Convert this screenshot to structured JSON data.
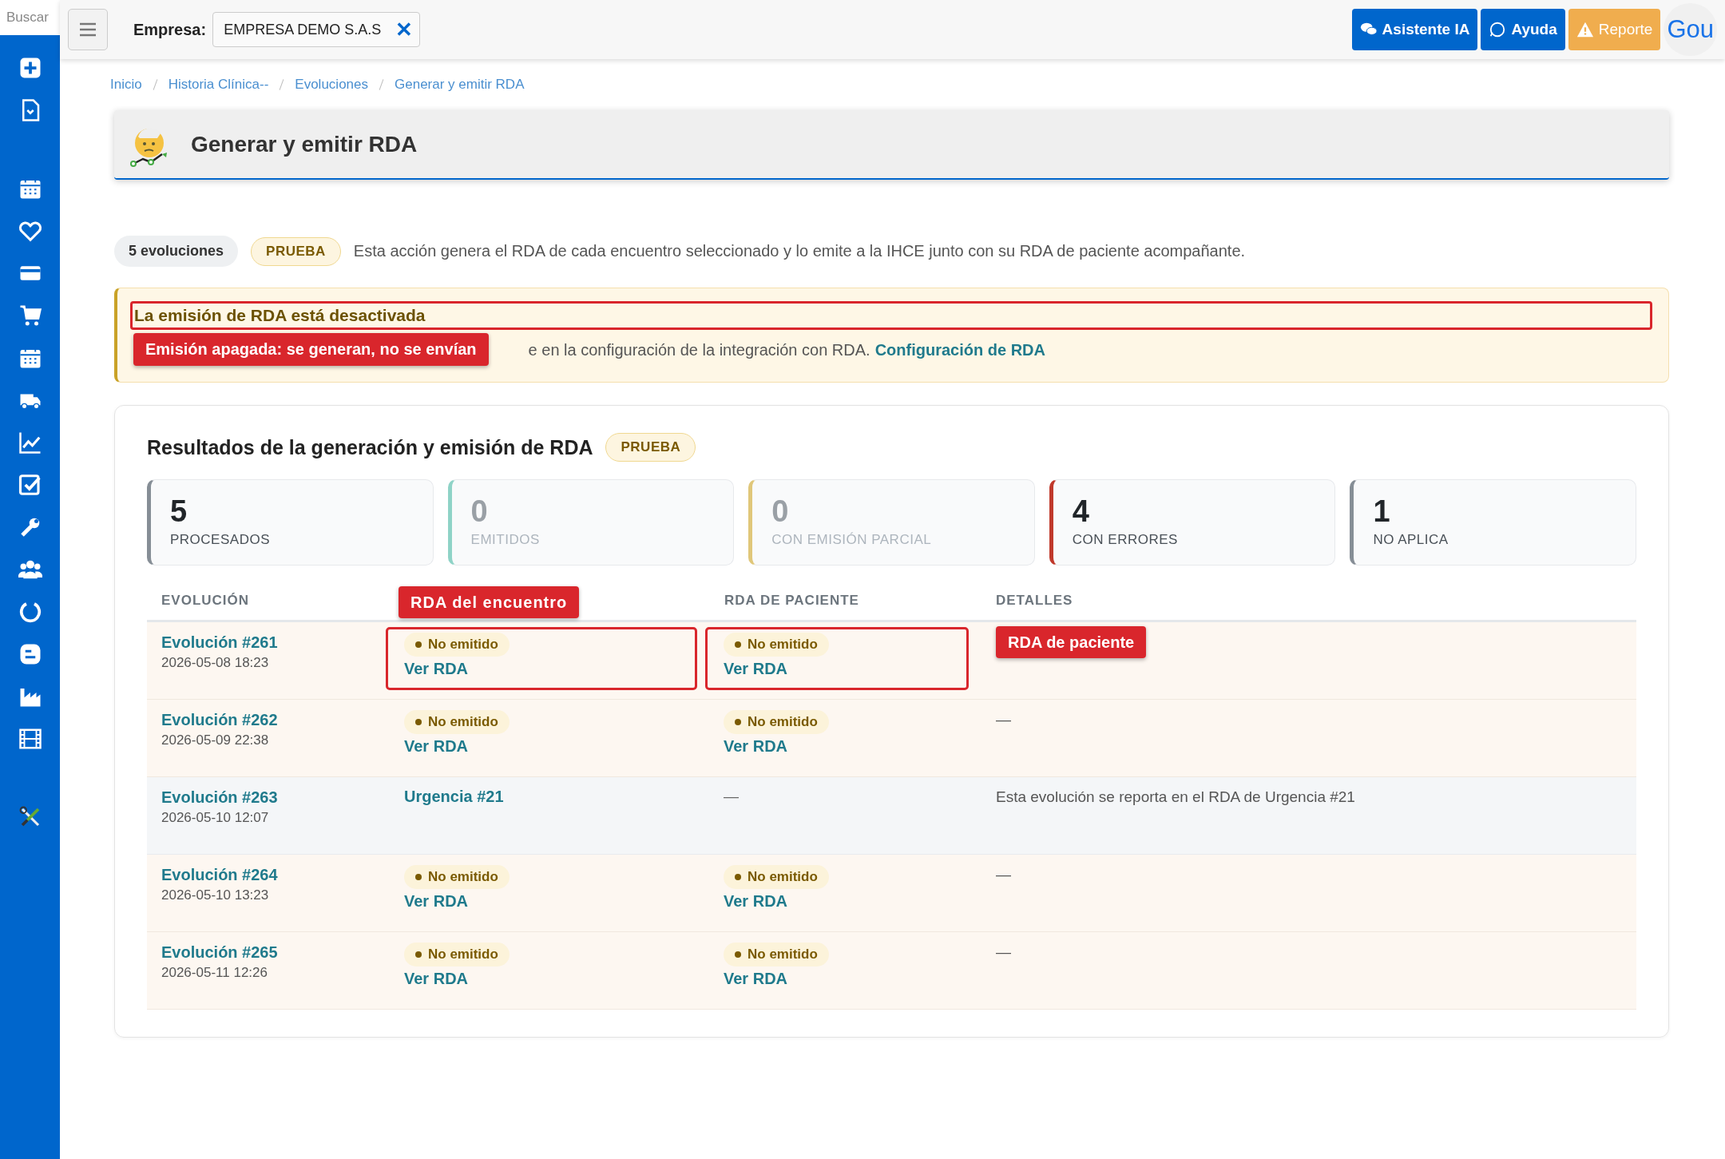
{
  "topbar": {
    "search": {
      "placeholder": "Buscar"
    },
    "company_label": "Empresa:",
    "company": {
      "value": "EMPRESA DEMO S.A.S",
      "clear": "✕"
    },
    "buttons": [
      {
        "kind": "chat",
        "label": "Asistente IA"
      },
      {
        "kind": "whatsapp",
        "label": "Ayuda"
      },
      {
        "kind": "warning",
        "label": "Reporte"
      }
    ],
    "user": "Gou"
  },
  "breadcrumb": [
    "Inicio",
    "Historia Clínica--",
    "Evoluciones",
    "Generar y emitir RDA"
  ],
  "page_title": "Generar y emitir RDA",
  "summary": {
    "count": "5 evoluciones",
    "mode": "PRUEBA",
    "text": "Esta acción genera el RDA de cada encuentro seleccionado y lo emite a la IHCE junto con su RDA de paciente acompañante."
  },
  "warning": {
    "title": "La emisión de RDA está desactivada",
    "title_highlighted": true,
    "callout": "Emisión apagada: se generan, no se envían",
    "text": "e en la configuración de la integración con RDA.",
    "link": "Configuración de RDA"
  },
  "results": {
    "title": "Resultados de la generación y emisión de RDA",
    "mode": "PRUEBA",
    "stats": [
      {
        "value": "5",
        "label": "PROCESADOS",
        "color": "#868e96",
        "muted": false
      },
      {
        "value": "0",
        "label": "EMITIDOS",
        "color": "#8fd3c7",
        "muted": true
      },
      {
        "value": "0",
        "label": "CON EMISIÓN PARCIAL",
        "color": "#e0c77a",
        "muted": true
      },
      {
        "value": "4",
        "label": "CON ERRORES",
        "color": "#c0392b",
        "muted": false
      },
      {
        "value": "1",
        "label": "NO APLICA",
        "color": "#868e96",
        "muted": false
      }
    ],
    "table": {
      "columns": [
        "EVOLUCIÓN",
        "RDA DE PACIENTE",
        "DETALLES"
      ],
      "column_callout": "RDA del encuentro",
      "rows": [
        {
          "kind": "error",
          "evolution": "Evolución #261",
          "date": "2026-05-08 18:23",
          "encounter": {
            "status": "No emitido",
            "link": "Ver RDA",
            "highlighted": true
          },
          "patient": {
            "status": "No emitido",
            "link": "Ver RDA",
            "highlighted": true
          },
          "details": {
            "callout": "RDA de paciente"
          }
        },
        {
          "kind": "error",
          "evolution": "Evolución #262",
          "date": "2026-05-09 22:38",
          "encounter": {
            "status": "No emitido",
            "link": "Ver RDA",
            "highlighted": false
          },
          "patient": {
            "status": "No emitido",
            "link": "Ver RDA",
            "highlighted": false
          },
          "details": {
            "text": "—"
          }
        },
        {
          "kind": "not-applicable",
          "evolution": "Evolución #263",
          "date": "2026-05-10 12:07",
          "encounter": {
            "link": "Urgencia #21",
            "highlighted": false
          },
          "patient": {
            "text": "—",
            "highlighted": false
          },
          "details": {
            "text": "Esta evolución se reporta en el RDA de Urgencia #21"
          }
        },
        {
          "kind": "error",
          "evolution": "Evolución #264",
          "date": "2026-05-10 13:23",
          "encounter": {
            "status": "No emitido",
            "link": "Ver RDA",
            "highlighted": false
          },
          "patient": {
            "status": "No emitido",
            "link": "Ver RDA",
            "highlighted": false
          },
          "details": {
            "text": "—"
          }
        },
        {
          "kind": "error",
          "evolution": "Evolución #265",
          "date": "2026-05-11 12:26",
          "encounter": {
            "status": "No emitido",
            "link": "Ver RDA",
            "highlighted": false
          },
          "patient": {
            "status": "No emitido",
            "link": "Ver RDA",
            "highlighted": false
          },
          "details": {
            "text": "—"
          }
        }
      ]
    }
  }
}
